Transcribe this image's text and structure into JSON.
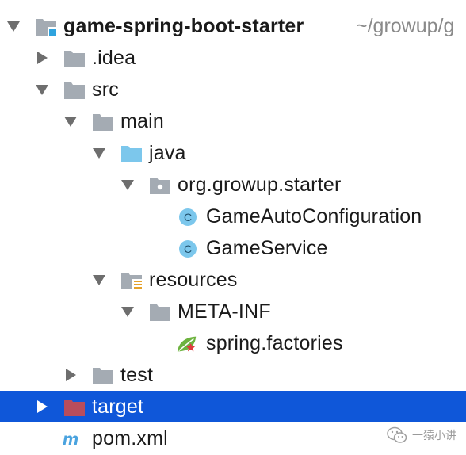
{
  "colors": {
    "selection": "#0f57d9",
    "folder_gray": "#a4abb3",
    "source_folder": "#7cc7ec",
    "class_icon": "#7cc7ec",
    "target_folder": "#b84d5c",
    "maven_icon": "#4aa3df"
  },
  "tree": {
    "project": {
      "name": "game-spring-boot-starter",
      "path": "~/growup/g",
      "icon": "module-folder-icon",
      "expanded": true
    },
    "idea": {
      "name": ".idea",
      "icon": "folder-icon",
      "expanded": false
    },
    "src": {
      "name": "src",
      "icon": "folder-icon",
      "expanded": true
    },
    "main": {
      "name": "main",
      "icon": "folder-icon",
      "expanded": true
    },
    "java": {
      "name": "java",
      "icon": "source-folder-icon",
      "expanded": true
    },
    "package": {
      "name": "org.growup.starter",
      "icon": "package-icon",
      "expanded": true
    },
    "class1": {
      "name": "GameAutoConfiguration",
      "icon": "class-icon",
      "letter": "C"
    },
    "class2": {
      "name": "GameService",
      "icon": "class-icon",
      "letter": "C"
    },
    "resources": {
      "name": "resources",
      "icon": "resources-folder-icon",
      "expanded": true
    },
    "metainf": {
      "name": "META-INF",
      "icon": "folder-icon",
      "expanded": true
    },
    "factories": {
      "name": "spring.factories",
      "icon": "spring-leaf-icon"
    },
    "test": {
      "name": "test",
      "icon": "folder-icon",
      "expanded": false
    },
    "target": {
      "name": "target",
      "icon": "excluded-folder-icon",
      "expanded": false,
      "selected": true
    },
    "pom": {
      "name": "pom.xml",
      "icon": "maven-icon",
      "letter": "m"
    }
  },
  "watermark": {
    "text": "一猿小讲",
    "icon": "wechat-icon"
  }
}
